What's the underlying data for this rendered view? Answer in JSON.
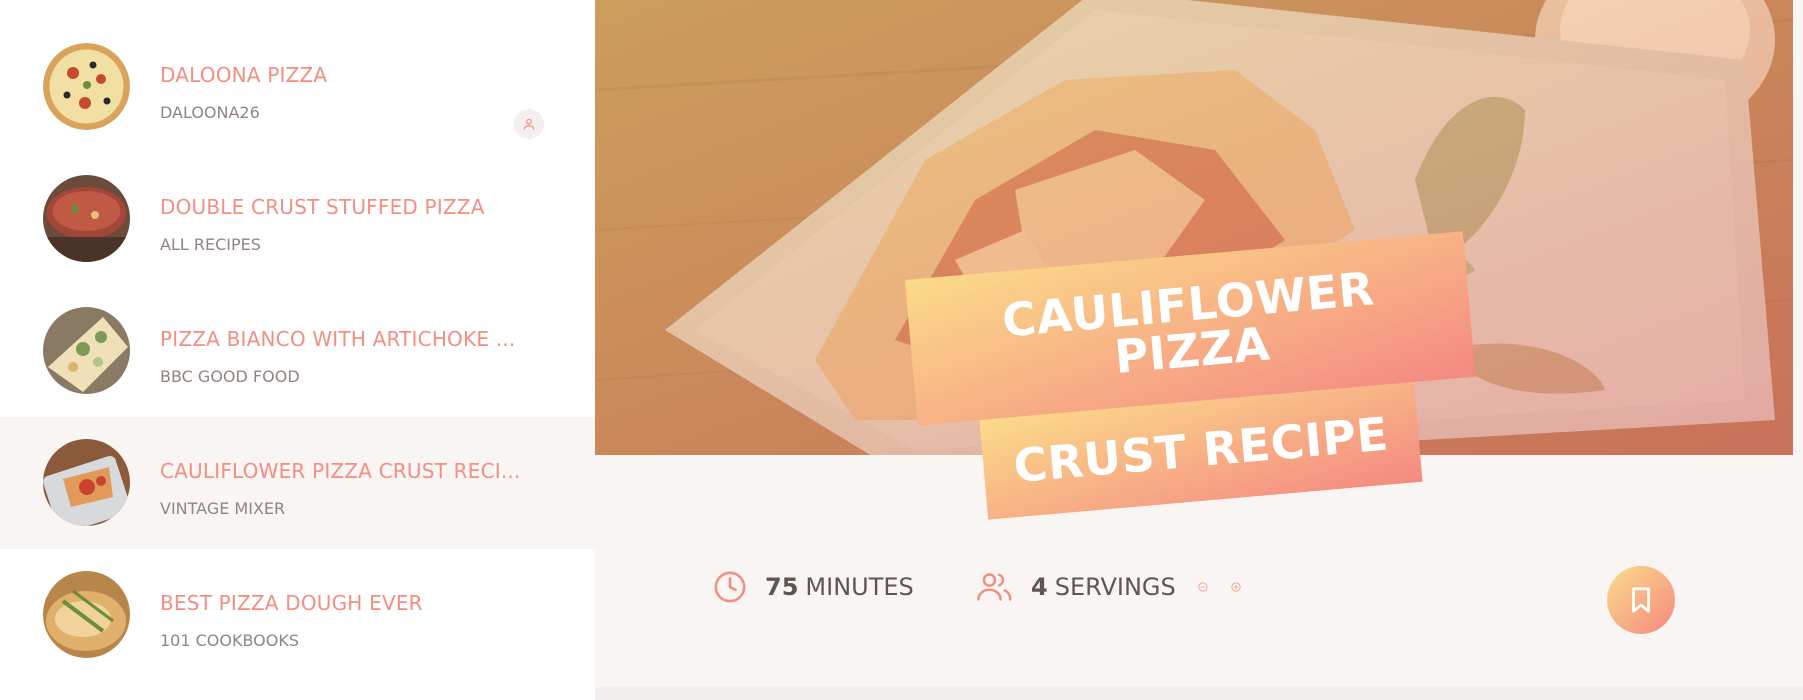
{
  "results": [
    {
      "title": "DALOONA PIZZA",
      "publisher": "DALOONA26",
      "user_generated": true,
      "active": false
    },
    {
      "title": "DOUBLE CRUST STUFFED PIZZA",
      "publisher": "ALL RECIPES",
      "user_generated": false,
      "active": false
    },
    {
      "title": "PIZZA BIANCO WITH ARTICHOKE ...",
      "publisher": "BBC GOOD FOOD",
      "user_generated": false,
      "active": false
    },
    {
      "title": "CAULIFLOWER PIZZA CRUST RECI...",
      "publisher": "VINTAGE MIXER",
      "user_generated": false,
      "active": true
    },
    {
      "title": "BEST PIZZA DOUGH EVER",
      "publisher": "101 COOKBOOKS",
      "user_generated": false,
      "active": false
    }
  ],
  "recipe": {
    "title_line1": "CAULIFLOWER PIZZA",
    "title_line2": "CRUST RECIPE",
    "cooking_time": "75",
    "cooking_time_unit": "MINUTES",
    "servings": "4",
    "servings_unit": "SERVINGS"
  },
  "icons": {
    "time": "clock-icon",
    "servings": "users-icon",
    "decrease": "minus-circle-icon",
    "increase": "plus-circle-icon",
    "bookmark": "bookmark-icon",
    "user_generated": "user-icon"
  },
  "colors": {
    "accent": "#f38e82",
    "gradient_start": "#fbdb89",
    "gradient_end": "#f48982",
    "text": "#615551",
    "muted": "#918581",
    "bg": "#f9f5f3"
  }
}
